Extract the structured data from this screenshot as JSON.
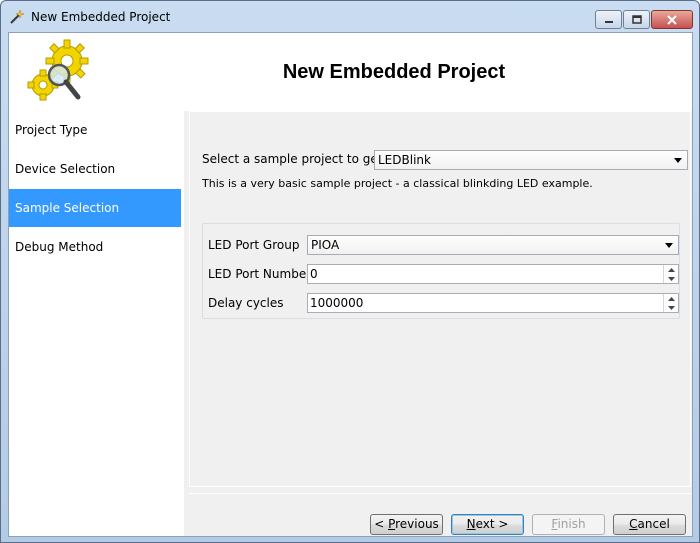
{
  "window": {
    "title": "New Embedded Project"
  },
  "header": {
    "title": "New Embedded Project"
  },
  "sidebar": {
    "items": [
      {
        "label": "Project Type"
      },
      {
        "label": "Device Selection"
      },
      {
        "label": "Sample Selection"
      },
      {
        "label": "Debug Method"
      }
    ],
    "active_index": 2
  },
  "sample": {
    "label": "Select a sample project to generate:",
    "value": "LEDBlink",
    "description": "This is a very basic sample project - a classical blinkding LED example."
  },
  "params": {
    "port_group_label": "LED Port Group",
    "port_group_value": "PIOA",
    "port_number_label": "LED Port Number",
    "port_number_value": "0",
    "delay_label": "Delay cycles",
    "delay_value": "1000000"
  },
  "buttons": {
    "previous_prefix": "< ",
    "previous_key": "P",
    "previous_rest": "revious",
    "next_key": "N",
    "next_rest": "ext >",
    "finish_key": "F",
    "finish_rest": "inish",
    "cancel_key": "C",
    "cancel_rest": "ancel"
  },
  "colors": {
    "selection": "#3399ff",
    "frame": "#b9d1ea"
  }
}
